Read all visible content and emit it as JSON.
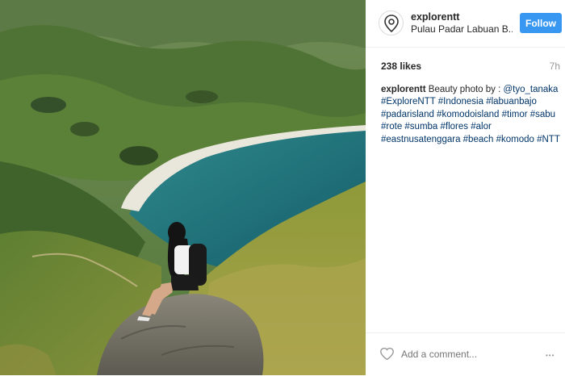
{
  "post": {
    "username": "explorentt",
    "location": "Pulau Padar Labuan B...",
    "follow_label": "Follow",
    "likes": "238 likes",
    "time": "7h",
    "caption_user": "explorentt",
    "caption_text": " Beauty photo by : ",
    "caption_tags": "@tyo_tanaka #ExploreNTT #Indonesia #labuanbajo #padarisland #komodoisland #timor #sabu #rote #sumba #flores #alor #eastnusatenggara #beach #komodo #NTT",
    "comment_placeholder": "Add a comment...",
    "more_label": "•••"
  },
  "colors": {
    "accent": "#3897f0",
    "hashtag": "#003569",
    "muted": "#999999"
  },
  "icons": [
    "location-pin-icon",
    "heart-icon",
    "more-options-icon"
  ]
}
